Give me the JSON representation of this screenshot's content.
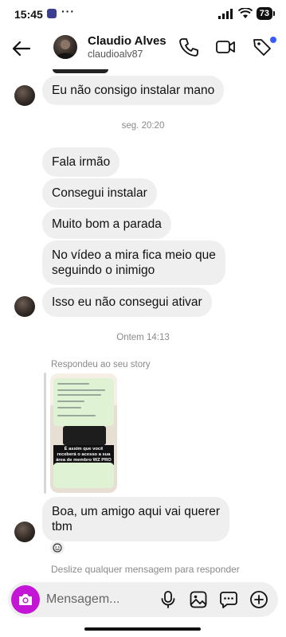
{
  "status_bar": {
    "time": "15:45",
    "dots": "···",
    "battery": "73"
  },
  "header": {
    "name": "Claudio Alves",
    "username": "claudioalv87"
  },
  "messages": [
    {
      "text": "Eu não consigo instalar mano"
    },
    {
      "text": "Fala irmão"
    },
    {
      "text": "Consegui instalar"
    },
    {
      "text": "Muito bom a parada"
    },
    {
      "text": "No vídeo a mira fica meio que\nseguindo o inimigo"
    },
    {
      "text": "Isso eu não consegui ativar"
    },
    {
      "text": "Boa, um amigo aqui vai querer\ntbm"
    }
  ],
  "time_separators": [
    "seg. 20:20",
    "Ontem 14:13"
  ],
  "story_reply": {
    "label": "Respondeu ao seu story",
    "caption": "É assim que você receberá o acesso a sua área de membro WZ PRO"
  },
  "swipe_hint": "Deslize qualquer mensagem para responder",
  "composer": {
    "placeholder": "Mensagem..."
  },
  "colors": {
    "bubble": "#efefef",
    "camera_button": "#c414d6",
    "notification_dot": "#3b5bfd"
  }
}
